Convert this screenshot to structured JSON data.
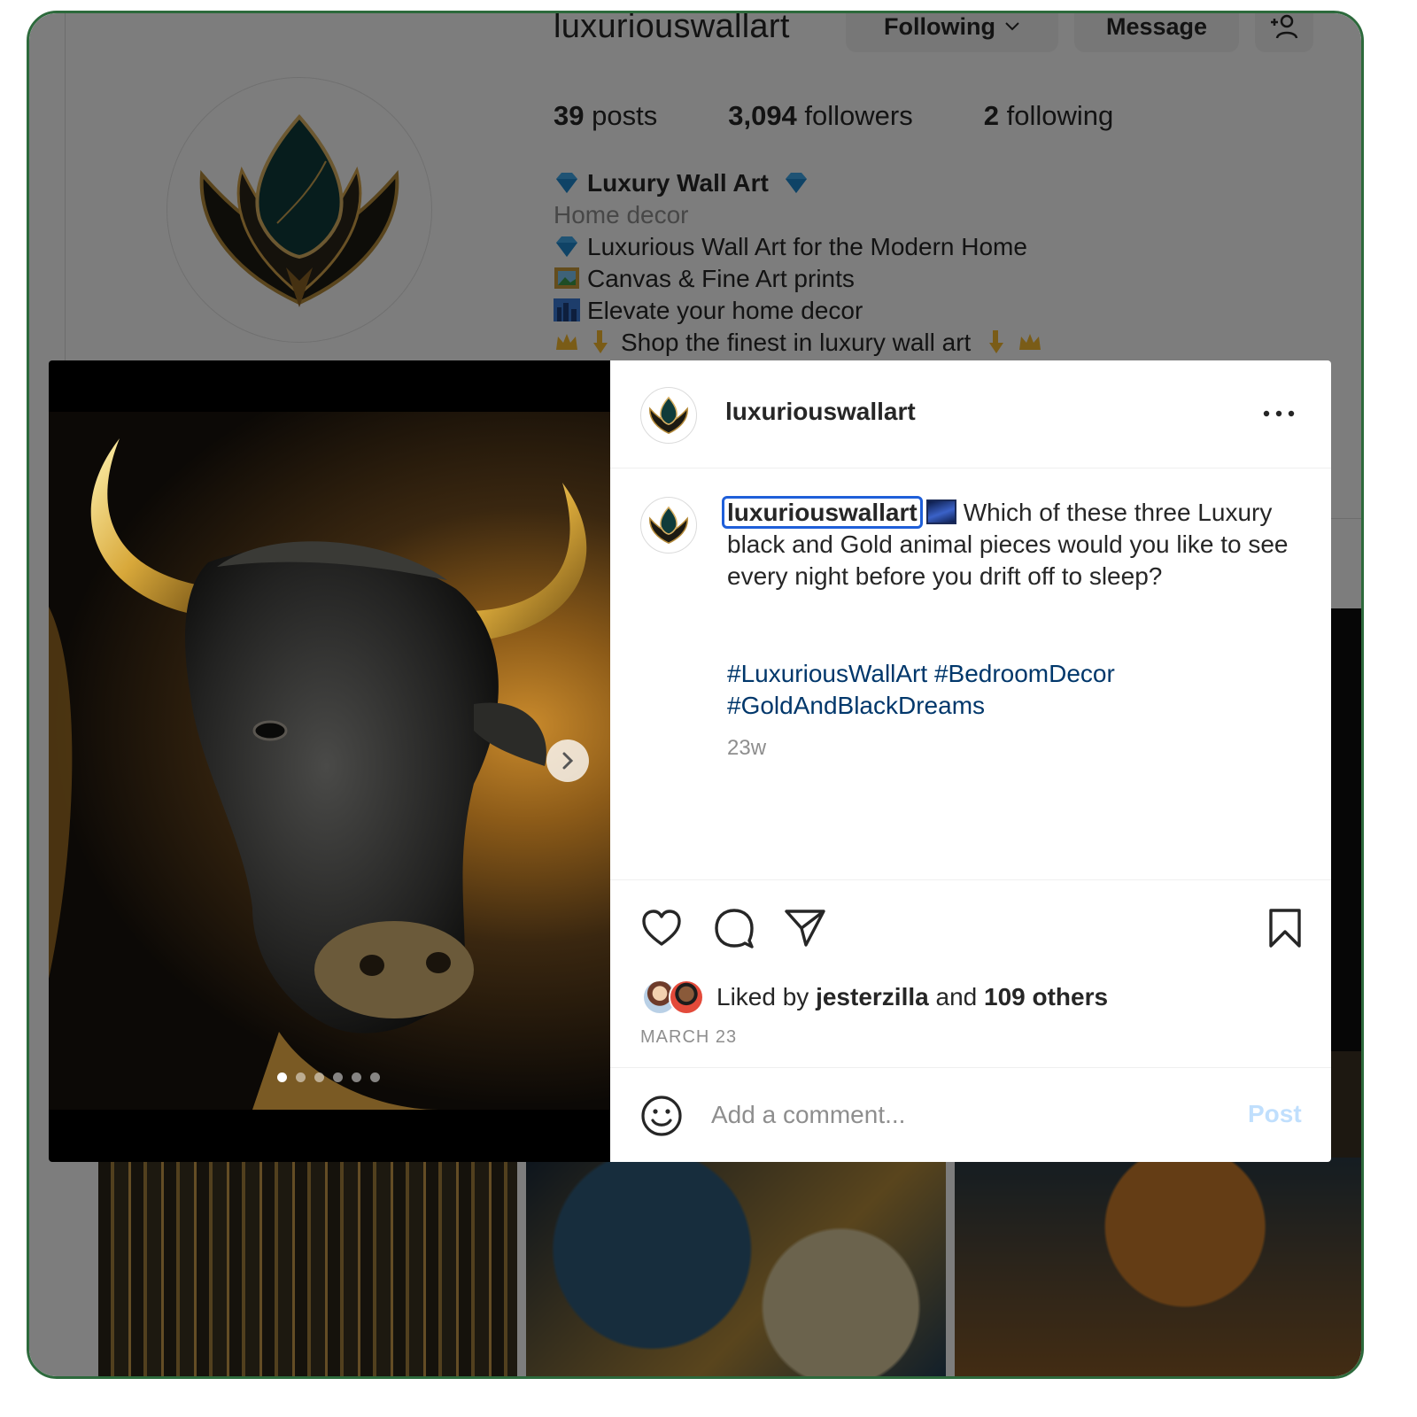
{
  "profile": {
    "username": "luxuriouswallart",
    "following_label": "Following",
    "message_label": "Message",
    "stats": [
      {
        "value": "39",
        "label": "posts"
      },
      {
        "value": "3,094",
        "label": "followers"
      },
      {
        "value": "2",
        "label": "following"
      }
    ],
    "bio": {
      "name": "Luxury Wall Art",
      "category": "Home decor",
      "line1": "Luxurious Wall Art for the Modern Home",
      "line2": "Canvas & Fine Art prints",
      "line3": "Elevate your home decor",
      "line4": "Shop the finest in luxury wall art"
    }
  },
  "post": {
    "username": "luxuriouswallart",
    "caption_user": "luxuriouswallart",
    "caption_text": "Which of these three Luxury black and Gold animal pieces would you like to see every night before you drift off to sleep?",
    "hashtags_line1": "#LuxuriousWallArt #BedroomDecor",
    "hashtags_line2": "#GoldAndBlackDreams",
    "age": "23w",
    "liked_prefix": "Liked by",
    "liked_user": "jesterzilla",
    "liked_and": "and",
    "liked_others": "109 others",
    "date": "MARCH 23",
    "comment_placeholder": "Add a comment...",
    "post_label": "Post",
    "carousel": {
      "total": 6,
      "active_index": 0
    }
  },
  "colors": {
    "frame_border": "#2d6a3c",
    "hashtag": "#00376b",
    "post_button_disabled": "#c0dffd",
    "mention_highlight": "#1f5fd9"
  },
  "icons": {
    "more": "more-horizontal-icon",
    "like": "heart-icon",
    "comment": "comment-bubble-icon",
    "share": "paper-plane-icon",
    "save": "bookmark-icon",
    "emoji": "smiley-icon",
    "next": "chevron-right-icon",
    "add_person": "add-person-icon",
    "dropdown": "chevron-down-icon"
  }
}
